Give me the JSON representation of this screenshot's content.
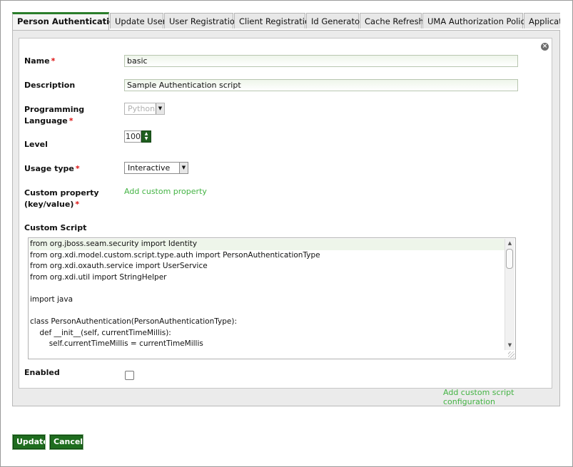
{
  "tabs": [
    {
      "label": "Person Authentication",
      "active": true
    },
    {
      "label": "Update User",
      "active": false
    },
    {
      "label": "User Registration",
      "active": false
    },
    {
      "label": "Client Registration",
      "active": false
    },
    {
      "label": "Id Generator",
      "active": false
    },
    {
      "label": "Cache Refresh",
      "active": false
    },
    {
      "label": "UMA Authorization Policies",
      "active": false
    },
    {
      "label": "Applicati",
      "active": false
    }
  ],
  "form": {
    "name_label": "Name",
    "name_value": "basic",
    "description_label": "Description",
    "description_value": "Sample Authentication script",
    "programming_language_label_1": "Programming",
    "programming_language_label_2": "Language",
    "programming_language_value": "Python",
    "level_label": "Level",
    "level_value": "100",
    "usage_type_label": "Usage type",
    "usage_type_value": "Interactive",
    "custom_property_label_1": "Custom property",
    "custom_property_label_2": "(key/value)",
    "add_custom_property": "Add custom property",
    "custom_script_label": "Custom Script",
    "script_lines": [
      "from org.jboss.seam.security import Identity",
      "from org.xdi.model.custom.script.type.auth import PersonAuthenticationType",
      "from org.xdi.oxauth.service import UserService",
      "from org.xdi.util import StringHelper",
      "",
      "import java",
      "",
      "class PersonAuthentication(PersonAuthenticationType):",
      "    def __init__(self, currentTimeMillis):",
      "        self.currentTimeMillis = currentTimeMillis"
    ],
    "enabled_label": "Enabled",
    "enabled_checked": false,
    "required_marker": "*"
  },
  "add_script_configuration": "Add custom script configuration",
  "buttons": {
    "update": "Update",
    "cancel": "Cancel"
  },
  "colors": {
    "accent_green": "#1e6d1e",
    "link_green": "#44b344",
    "required_red": "#d11111"
  }
}
